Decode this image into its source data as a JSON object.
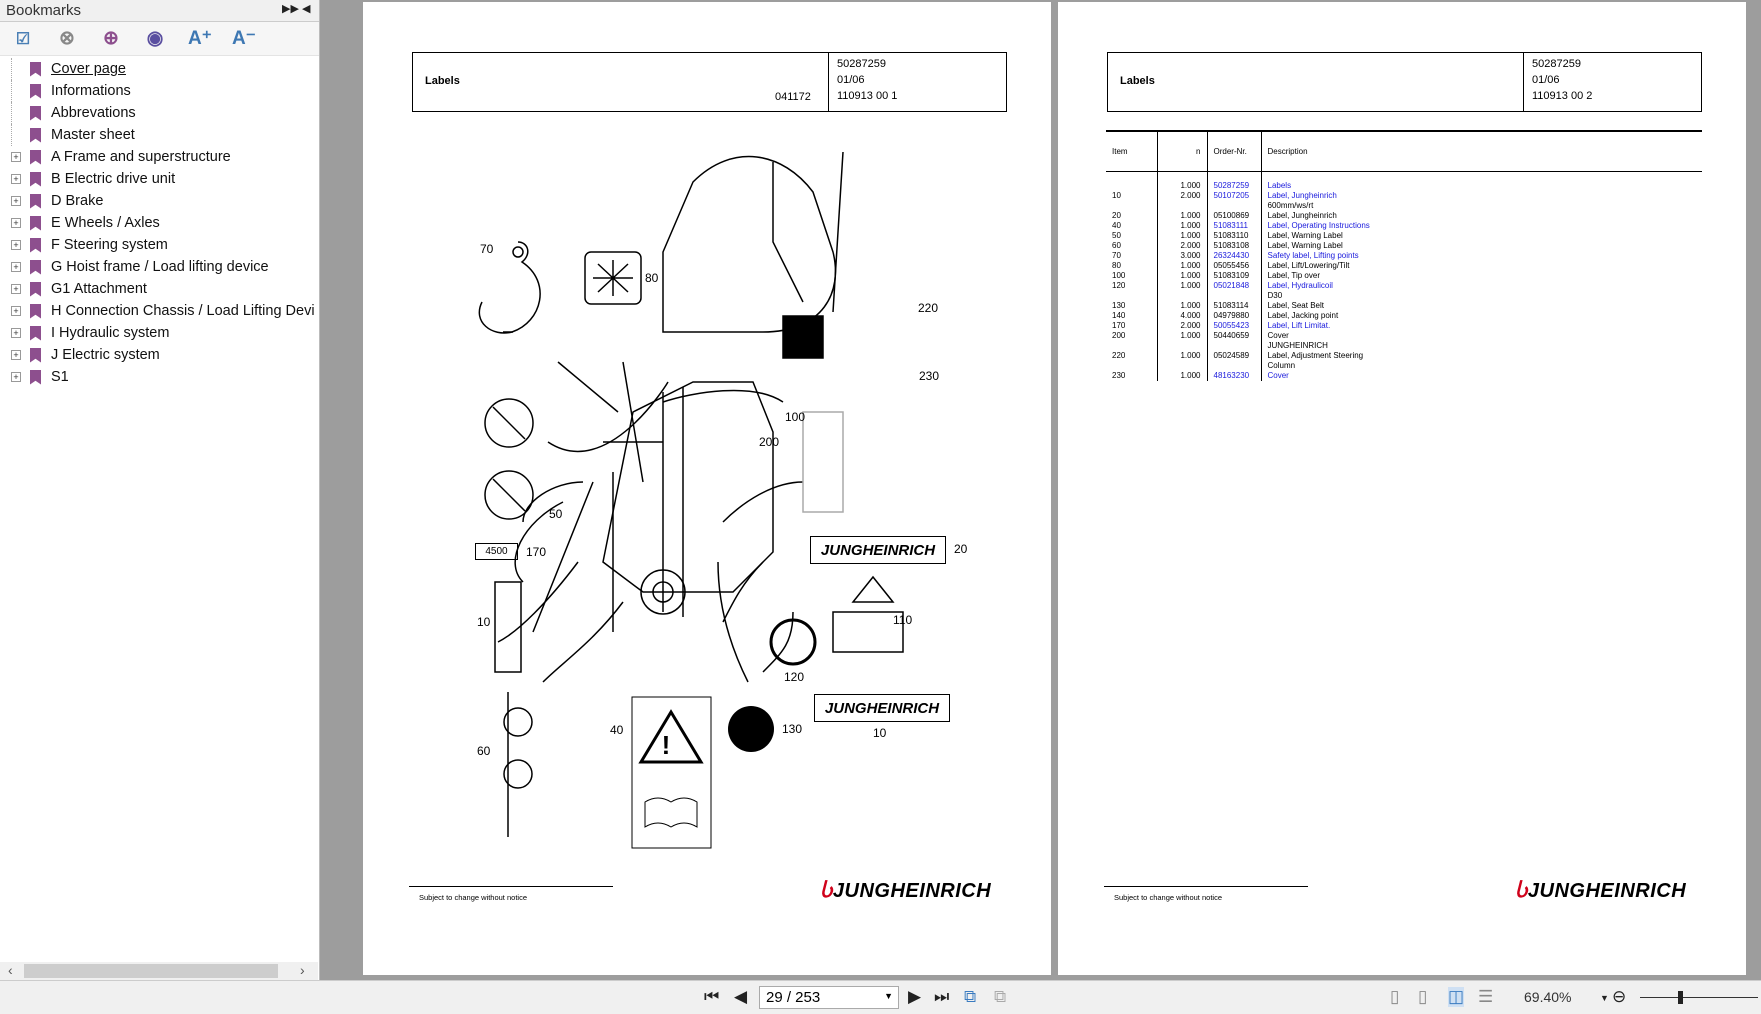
{
  "sidebar": {
    "title": "Bookmarks",
    "tools": [
      "bookmark-options",
      "delete-bookmark",
      "add-bookmark",
      "bookmark-properties",
      "A+",
      "A-"
    ],
    "items": [
      {
        "label": "Cover page",
        "expandable": false,
        "selected": true
      },
      {
        "label": "Informations",
        "expandable": false
      },
      {
        "label": "Abbrevations",
        "expandable": false
      },
      {
        "label": "Master sheet",
        "expandable": false
      },
      {
        "label": "A Frame and superstructure",
        "expandable": true
      },
      {
        "label": "B Electric drive unit",
        "expandable": true
      },
      {
        "label": "D Brake",
        "expandable": true
      },
      {
        "label": "E Wheels / Axles",
        "expandable": true
      },
      {
        "label": "F Steering system",
        "expandable": true
      },
      {
        "label": "G Hoist frame / Load lifting device",
        "expandable": true
      },
      {
        "label": "G1 Attachment",
        "expandable": true
      },
      {
        "label": "H Connection Chassis / Load Lifting Devi",
        "expandable": true
      },
      {
        "label": "I Hydraulic system",
        "expandable": true
      },
      {
        "label": "J Electric system",
        "expandable": true
      },
      {
        "label": "S1",
        "expandable": true
      }
    ]
  },
  "left_page": {
    "title": "Labels",
    "doc_no": "50287259",
    "date": "01/06",
    "ref": "041172",
    "page_code": "110913 00 1",
    "footer": "Subject to change without notice",
    "logo": "JUNGHEINRICH",
    "callouts": [
      "70",
      "80",
      "220",
      "230",
      "100",
      "200",
      "50",
      "170",
      "20",
      "10",
      "110",
      "120",
      "40",
      "130",
      "10",
      "60"
    ],
    "tag_4500": "4500",
    "brand_label": "JUNGHEINRICH"
  },
  "right_page": {
    "title": "Labels",
    "doc_no": "50287259",
    "date": "01/06",
    "page_code": "110913 00 2",
    "footer": "Subject to change without notice",
    "logo": "JUNGHEINRICH",
    "columns": [
      "Item",
      "n",
      "Order-Nr.",
      "Description"
    ],
    "rows": [
      {
        "item": "",
        "n": "1.000",
        "order": "50287259",
        "desc": "Labels",
        "link": true
      },
      {
        "item": "10",
        "n": "2.000",
        "order": "50107205",
        "desc": "Label, Jungheinrich",
        "desc2": "600mm/ws/rt",
        "link": true
      },
      {
        "item": "20",
        "n": "1.000",
        "order": "05100869",
        "desc": "Label, Jungheinrich"
      },
      {
        "item": "40",
        "n": "1.000",
        "order": "51083111",
        "desc": "Label, Operating Instructions",
        "link": true
      },
      {
        "item": "50",
        "n": "1.000",
        "order": "51083110",
        "desc": "Label, Warning Label"
      },
      {
        "item": "60",
        "n": "2.000",
        "order": "51083108",
        "desc": "Label, Warning Label"
      },
      {
        "item": "70",
        "n": "3.000",
        "order": "26324430",
        "desc": "Safety label, Lifting points",
        "link": true
      },
      {
        "item": "80",
        "n": "1.000",
        "order": "05055456",
        "desc": "Label, Lift/Lowering/Tilt"
      },
      {
        "item": "100",
        "n": "1.000",
        "order": "51083109",
        "desc": "Label, Tip over"
      },
      {
        "item": "120",
        "n": "1.000",
        "order": "05021848",
        "desc": "Label, Hydraulicoil",
        "desc2": "D30",
        "link": true
      },
      {
        "item": "130",
        "n": "1.000",
        "order": "51083114",
        "desc": "Label, Seat Belt"
      },
      {
        "item": "140",
        "n": "4.000",
        "order": "04979880",
        "desc": "Label, Jacking point"
      },
      {
        "item": "170",
        "n": "2.000",
        "order": "50055423",
        "desc": "Label, Lift  Limitat.",
        "link": true
      },
      {
        "item": "200",
        "n": "1.000",
        "order": "50440659",
        "desc": "Cover",
        "desc2": "JUNGHEINRICH"
      },
      {
        "item": "220",
        "n": "1.000",
        "order": "05024589",
        "desc": "Label, Adjustment Steering",
        "desc2": "Column"
      },
      {
        "item": "230",
        "n": "1.000",
        "order": "48163230",
        "desc": "Cover",
        "link": true
      }
    ]
  },
  "navigation": {
    "page_value": "29 / 253",
    "zoom": "69.40%",
    "zoom_level_percent": 69.4,
    "link_color": "#1a1adc",
    "bookmark_color": "#8d4f8e"
  }
}
